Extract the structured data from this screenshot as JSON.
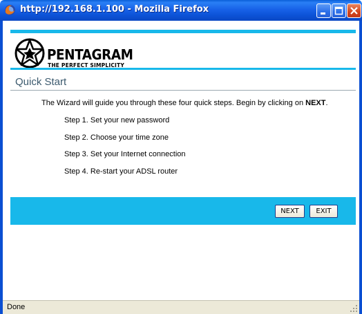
{
  "window": {
    "title": "http://192.168.1.100 - Mozilla Firefox",
    "app_icon": "firefox-icon",
    "controls": [
      "minimize-icon",
      "maximize-icon",
      "close-icon"
    ]
  },
  "brand": {
    "name": "PENTAGRAM",
    "tagline": "THE PERFECT SIMPLICITY",
    "logo_icon": "star-pentagon-icon"
  },
  "page": {
    "title": "Quick Start",
    "intro_prefix": "The Wizard will guide you through these four quick steps. Begin by clicking on ",
    "intro_keyword": "NEXT",
    "intro_suffix": ".",
    "steps": [
      "Step 1. Set your new password",
      "Step 2. Choose your time zone",
      "Step 3. Set your Internet connection",
      "Step 4. Re-start your ADSL router"
    ]
  },
  "actions": {
    "next_label": "NEXT",
    "exit_label": "EXIT"
  },
  "status": {
    "text": "Done"
  },
  "colors": {
    "accent": "#18b8ea",
    "titlebar": "#1862e8",
    "close_button": "#d4451b"
  }
}
